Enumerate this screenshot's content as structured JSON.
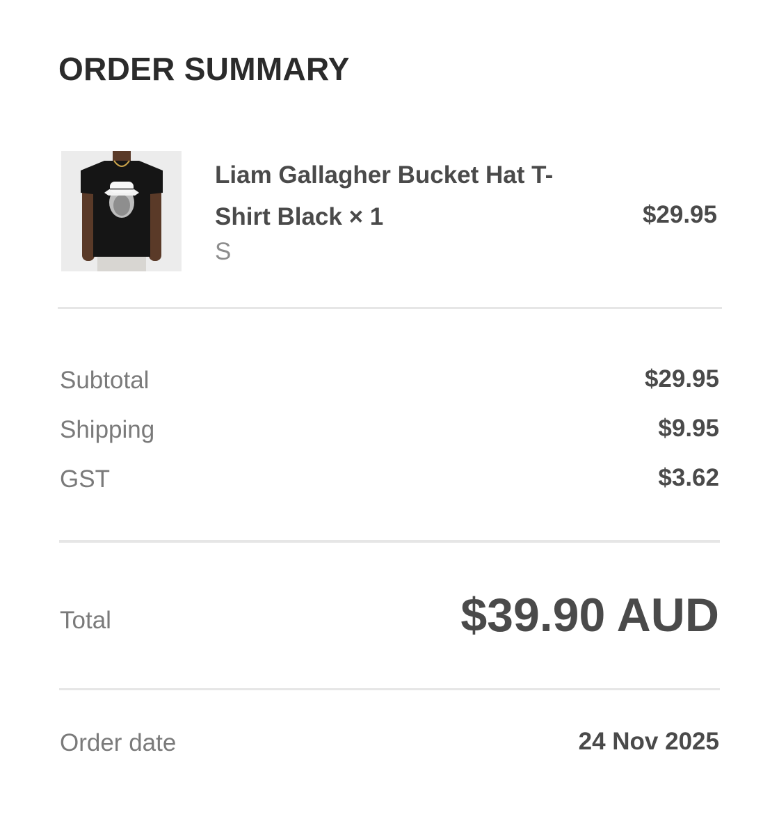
{
  "summary": {
    "title": "ORDER SUMMARY"
  },
  "item": {
    "name": "Liam Gallagher Bucket Hat T-Shirt Black × 1",
    "variant": "S",
    "price": "$29.95",
    "image_icon": "product-tshirt-photo"
  },
  "costs": {
    "subtotal_label": "Subtotal",
    "subtotal_value": "$29.95",
    "shipping_label": "Shipping",
    "shipping_value": "$9.95",
    "gst_label": "GST",
    "gst_value": "$3.62"
  },
  "total": {
    "label": "Total",
    "value": "$39.90 AUD"
  },
  "order": {
    "date_label": "Order date",
    "date_value": "24 Nov 2025"
  },
  "colors": {
    "background": "#ffffff",
    "text_primary": "#4a4a4a",
    "text_secondary": "#7a7a7a",
    "divider": "#e6e6e6"
  }
}
